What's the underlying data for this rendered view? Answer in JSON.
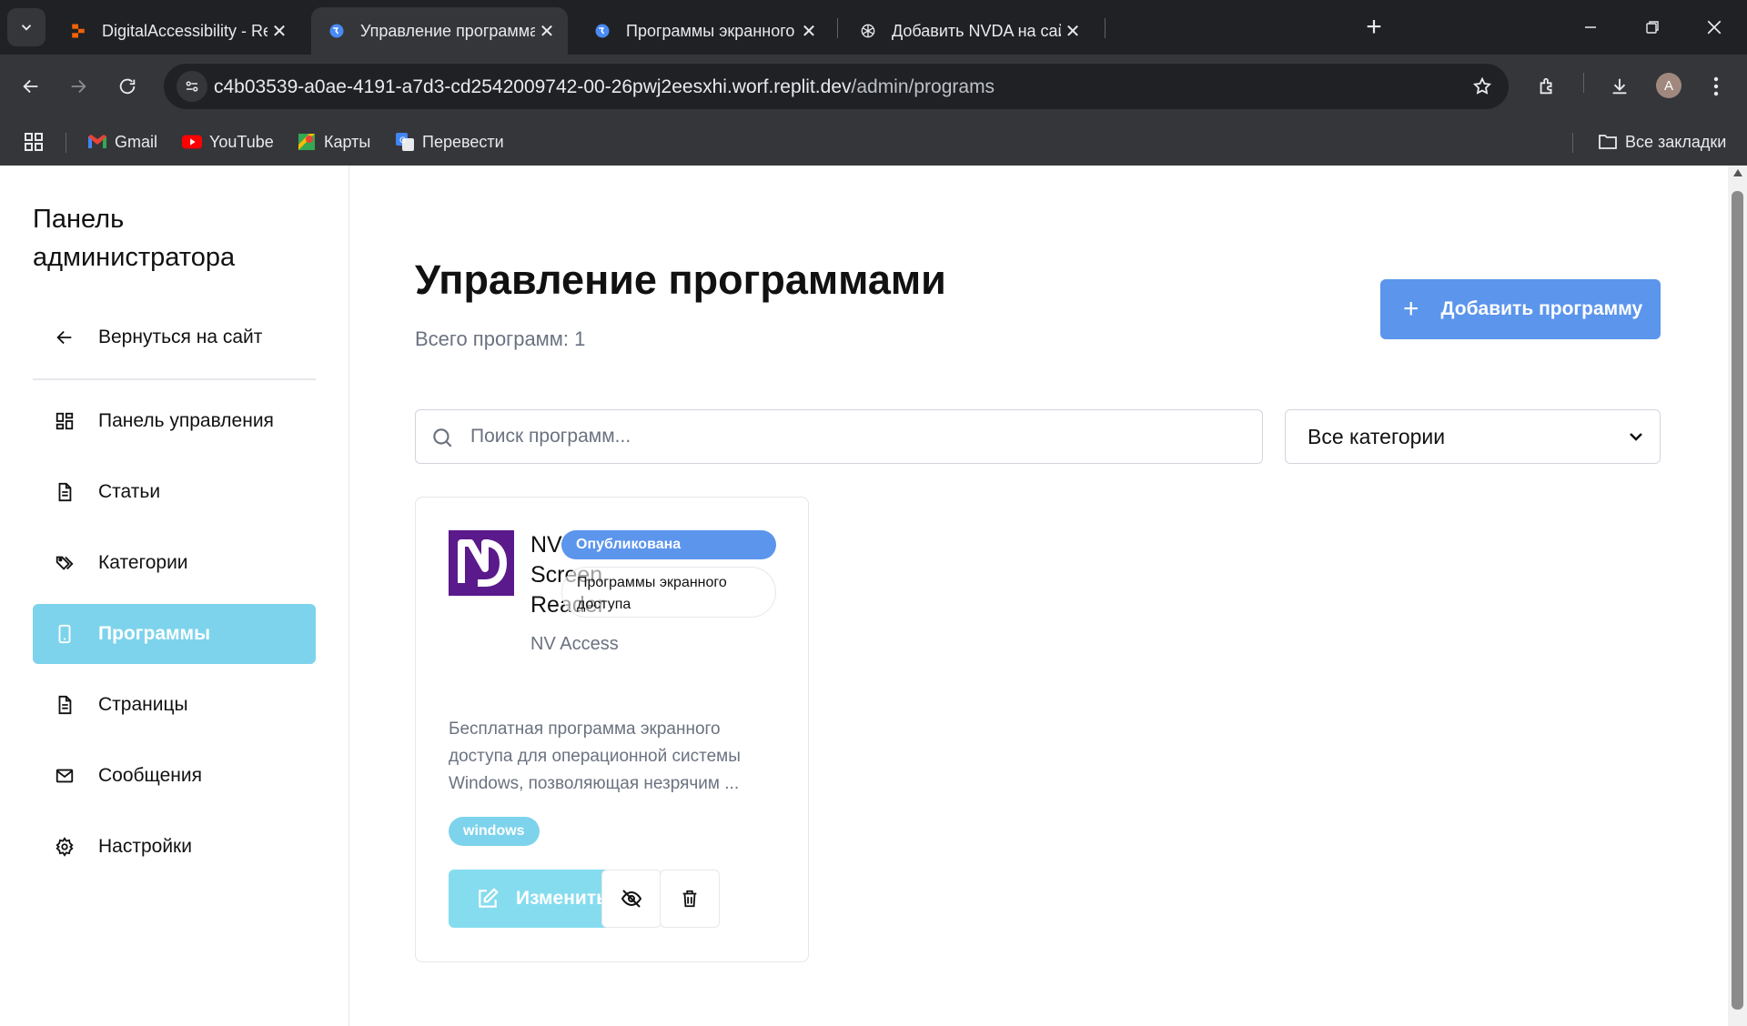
{
  "browser": {
    "tabs": [
      {
        "title": "DigitalAccessibility - Replit",
        "active": false
      },
      {
        "title": "Управление программами - A",
        "active": true
      },
      {
        "title": "Программы экранного доступ",
        "active": false
      },
      {
        "title": "Добавить NVDA на сайт",
        "active": false
      }
    ],
    "url_host": "c4b03539-a0ae-4191-a7d3-cd2542009742-00-26pwj2eesxhi.worf.replit.dev",
    "url_path": "/admin/programs",
    "avatar_letter": "A",
    "bookmarks": [
      "Gmail",
      "YouTube",
      "Карты",
      "Перевести"
    ],
    "all_bookmarks": "Все закладки"
  },
  "sidebar": {
    "title": "Панель администратора",
    "back": "Вернуться на сайт",
    "items": [
      {
        "label": "Панель управления",
        "icon": "dashboard-icon"
      },
      {
        "label": "Статьи",
        "icon": "document-icon"
      },
      {
        "label": "Категории",
        "icon": "tags-icon"
      },
      {
        "label": "Программы",
        "icon": "phone-icon",
        "active": true
      },
      {
        "label": "Страницы",
        "icon": "document-icon"
      },
      {
        "label": "Сообщения",
        "icon": "mail-icon"
      },
      {
        "label": "Настройки",
        "icon": "gear-icon"
      }
    ]
  },
  "main": {
    "title": "Управление программами",
    "count": "Всего программ: 1",
    "add_button": "Добавить программу",
    "search_placeholder": "Поиск программ...",
    "category_filter": "Все категории",
    "program": {
      "name": "NV Screen Reader",
      "vendor": "NV Access",
      "status": "Опубликована",
      "category": "Программы экранного доступа",
      "description": "Бесплатная программа экранного доступа для операционной системы Windows, позволяющая незрячим ...",
      "tag": "windows",
      "edit_button": "Изменить"
    }
  },
  "colors": {
    "primary": "#5b95ec",
    "accent": "#7dd3ec",
    "logo_bg": "#5b1a8c"
  }
}
